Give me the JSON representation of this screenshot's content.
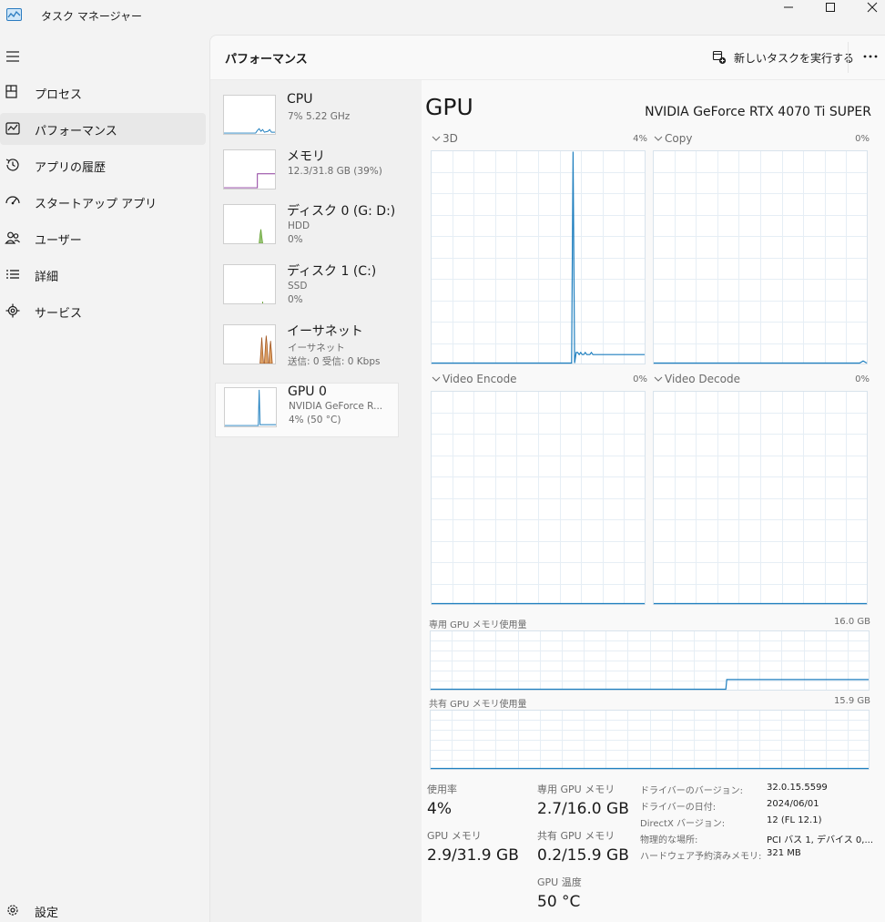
{
  "window": {
    "title": "タスク マネージャー",
    "accent": "#1f7fbf"
  },
  "sidebar": {
    "items": [
      {
        "label": "プロセス",
        "icon": "processes-icon",
        "selected": false
      },
      {
        "label": "パフォーマンス",
        "icon": "performance-icon",
        "selected": true
      },
      {
        "label": "アプリの履歴",
        "icon": "history-icon",
        "selected": false
      },
      {
        "label": "スタートアップ アプリ",
        "icon": "startup-icon",
        "selected": false
      },
      {
        "label": "ユーザー",
        "icon": "users-icon",
        "selected": false
      },
      {
        "label": "詳細",
        "icon": "details-icon",
        "selected": false
      },
      {
        "label": "サービス",
        "icon": "services-icon",
        "selected": false
      }
    ],
    "settings_label": "設定"
  },
  "header": {
    "title": "パフォーマンス",
    "new_task_label": "新しいタスクを実行する"
  },
  "devices": [
    {
      "name": "CPU",
      "sub1": "7%  5.22 GHz",
      "sub2": "",
      "color": "#1f7fbf"
    },
    {
      "name": "メモリ",
      "sub1": "12.3/31.8 GB (39%)",
      "sub2": "",
      "color": "#8b3a9c"
    },
    {
      "name": "ディスク 0 (G: D:)",
      "sub1": "HDD",
      "sub2": "0%",
      "color": "#5e9e2a"
    },
    {
      "name": "ディスク 1 (C:)",
      "sub1": "SSD",
      "sub2": "0%",
      "color": "#5e9e2a"
    },
    {
      "name": "イーサネット",
      "sub1": "イーサネット",
      "sub2": "送信: 0 受信: 0 Kbps",
      "color": "#a0521a"
    },
    {
      "name": "GPU 0",
      "sub1": "NVIDIA GeForce R...",
      "sub2": "4% (50 °C)",
      "color": "#1f7fbf"
    }
  ],
  "gpu": {
    "title": "GPU",
    "model": "NVIDIA GeForce RTX 4070 Ti SUPER",
    "engines": [
      {
        "name": "3D",
        "pct": "4%"
      },
      {
        "name": "Copy",
        "pct": "0%"
      },
      {
        "name": "Video Encode",
        "pct": "0%"
      },
      {
        "name": "Video Decode",
        "pct": "0%"
      }
    ],
    "dedicated_label": "専用 GPU メモリ使用量",
    "dedicated_max": "16.0 GB",
    "shared_label": "共有 GPU メモリ使用量",
    "shared_max": "15.9 GB",
    "stats": {
      "utilization_label": "使用率",
      "utilization_value": "4%",
      "gpu_memory_label": "GPU メモリ",
      "gpu_memory_value": "2.9/31.9 GB",
      "dedicated_memory_label": "専用 GPU メモリ",
      "dedicated_memory_value": "2.7/16.0 GB",
      "shared_memory_label": "共有 GPU メモリ",
      "shared_memory_value": "0.2/15.9 GB",
      "temp_label": "GPU 温度",
      "temp_value": "50 °C"
    },
    "properties": [
      {
        "label": "ドライバーのバージョン:",
        "value": "32.0.15.5599"
      },
      {
        "label": "ドライバーの日付:",
        "value": "2024/06/01"
      },
      {
        "label": "DirectX バージョン:",
        "value": "12 (FL 12.1)"
      },
      {
        "label": "物理的な場所:",
        "value": "PCI バス 1, デバイス 0,..."
      },
      {
        "label": "ハードウェア予約済みメモリ:",
        "value": "321 MB"
      }
    ]
  },
  "chart_data": [
    {
      "type": "line",
      "name": "3D",
      "ylim": [
        0,
        100
      ],
      "values": [
        0,
        0,
        0,
        0,
        0,
        0,
        0,
        0,
        0,
        0,
        0,
        0,
        0,
        0,
        0,
        0,
        0,
        0,
        0,
        0,
        0,
        0,
        0,
        0,
        0,
        0,
        0,
        0,
        0,
        0,
        0,
        0,
        0,
        0,
        0,
        0,
        0,
        0,
        0,
        0,
        0,
        0,
        0,
        0,
        0,
        0,
        0,
        0,
        0,
        0,
        0,
        0,
        0,
        0,
        0,
        0,
        0,
        0,
        0,
        0,
        0,
        0,
        0,
        0,
        0,
        0,
        0,
        0,
        0,
        0,
        0,
        0,
        0,
        0,
        0,
        0,
        0,
        0,
        0,
        0,
        0,
        0,
        0,
        0,
        0,
        0,
        0,
        0,
        0,
        0,
        0,
        0,
        0,
        100,
        0,
        5,
        5,
        4,
        5,
        4,
        4,
        5,
        4,
        4,
        4,
        5,
        4,
        4,
        4,
        4,
        4,
        4,
        4,
        4,
        4,
        4,
        4,
        4,
        4,
        4,
        4,
        4,
        4,
        4,
        4,
        4,
        4,
        4,
        4,
        4,
        4,
        4,
        4,
        4,
        4,
        4,
        4,
        4,
        4,
        4,
        4
      ]
    },
    {
      "type": "line",
      "name": "Copy",
      "ylim": [
        0,
        100
      ],
      "values": [
        0,
        0,
        0,
        0,
        0,
        0,
        0,
        0,
        0,
        0,
        0,
        0,
        0,
        0,
        0,
        0,
        0,
        0,
        0,
        0,
        0,
        0,
        0,
        0,
        0,
        0,
        0,
        0,
        0,
        0,
        0,
        0,
        0,
        0,
        0,
        0,
        0,
        0,
        0,
        0,
        0,
        0,
        0,
        0,
        0,
        0,
        0,
        0,
        0,
        0,
        0,
        0,
        0,
        0,
        0,
        0,
        0,
        0,
        1,
        0
      ]
    },
    {
      "type": "line",
      "name": "Video Encode",
      "ylim": [
        0,
        100
      ],
      "values": [
        0,
        0
      ]
    },
    {
      "type": "line",
      "name": "Video Decode",
      "ylim": [
        0,
        100
      ],
      "values": [
        0,
        0
      ]
    },
    {
      "type": "line",
      "name": "dedicated",
      "ylim": [
        0,
        16.0
      ],
      "values": [
        0,
        0,
        0,
        0,
        0,
        0,
        0,
        0,
        0,
        0,
        0,
        0,
        0,
        0,
        0,
        0,
        0,
        0,
        0,
        0,
        0,
        0,
        0,
        0,
        0,
        0,
        0,
        0,
        0,
        0,
        0,
        0,
        0,
        0,
        0,
        0,
        0,
        0,
        0,
        0,
        0,
        0,
        0,
        0,
        0,
        0,
        0,
        0,
        0,
        0,
        0,
        0,
        0,
        0,
        0,
        0,
        0,
        0,
        0,
        0,
        0,
        0,
        0,
        0,
        0,
        0,
        0,
        0,
        0,
        0,
        0,
        0,
        0,
        0,
        0,
        0,
        0,
        0,
        0,
        0,
        0,
        0,
        0,
        0,
        0,
        0,
        0,
        0,
        0,
        0,
        0,
        0,
        0,
        0,
        0,
        0,
        0,
        0,
        0,
        0,
        0,
        0,
        0,
        0,
        0,
        0,
        0,
        0,
        0,
        0,
        0,
        0,
        0,
        0,
        0,
        0,
        0,
        0,
        0,
        0,
        0,
        0,
        0,
        0,
        0,
        0,
        0,
        0,
        0,
        0,
        0,
        0,
        0,
        0,
        0,
        0,
        0,
        0,
        0,
        0,
        0,
        0,
        0,
        0,
        0,
        0,
        0,
        0,
        0,
        0,
        0,
        0,
        0,
        0,
        0,
        0,
        0,
        0,
        0,
        0,
        0,
        0,
        0,
        0,
        0,
        0,
        0,
        0,
        0,
        0,
        0,
        0,
        0,
        0,
        0,
        0,
        0,
        0,
        0,
        0,
        0,
        0,
        0,
        0,
        0,
        0,
        0,
        0,
        0,
        0,
        0,
        0,
        0,
        0,
        0,
        0,
        0,
        0,
        0,
        0,
        0,
        0,
        0,
        0,
        0,
        0,
        0,
        0,
        0,
        0,
        0,
        0,
        0,
        0,
        0,
        0,
        0,
        0,
        0,
        0,
        0,
        0,
        0,
        0,
        0,
        0,
        0,
        0,
        0,
        0,
        0,
        0,
        0,
        0,
        0,
        0,
        0,
        0,
        0,
        0,
        0,
        0,
        0,
        0,
        0,
        0,
        0,
        0,
        0,
        0,
        0,
        0,
        0,
        0,
        0,
        0,
        0,
        0,
        0,
        0,
        0,
        0,
        0,
        0,
        0,
        0,
        0,
        0,
        0,
        0,
        0,
        0,
        0,
        0,
        0,
        0,
        0,
        0,
        0,
        0,
        0,
        0,
        0,
        0,
        0,
        0,
        0,
        0,
        0,
        0,
        0,
        0,
        0,
        0,
        0,
        0,
        0,
        0,
        0,
        0,
        0,
        0,
        0,
        0,
        0,
        0,
        0,
        0,
        0,
        0,
        0,
        0,
        0,
        0,
        0,
        0,
        0,
        0,
        0,
        0,
        0,
        0,
        0,
        0,
        0,
        0,
        0,
        0,
        0,
        0,
        0,
        0,
        0,
        0,
        0,
        0,
        0,
        0,
        2.7,
        2.7,
        2.7,
        2.7,
        2.7,
        2.7,
        2.7,
        2.7,
        2.7,
        2.7,
        2.7,
        2.7,
        2.7,
        2.7,
        2.7,
        2.7,
        2.7,
        2.7,
        2.7,
        2.7,
        2.7,
        2.7,
        2.7,
        2.7,
        2.7,
        2.7,
        2.7,
        2.7,
        2.7,
        2.7,
        2.7,
        2.7,
        2.7,
        2.7,
        2.7,
        2.7,
        2.7,
        2.7,
        2.7,
        2.7,
        2.7,
        2.7,
        2.7,
        2.7,
        2.7,
        2.7,
        2.7,
        2.7,
        2.7,
        2.7,
        2.7,
        2.7,
        2.7,
        2.7,
        2.7,
        2.7,
        2.7,
        2.7,
        2.7,
        2.7,
        2.7,
        2.7,
        2.7,
        2.7,
        2.7,
        2.7,
        2.7,
        2.7,
        2.7,
        2.7,
        2.7,
        2.7,
        2.7,
        2.7,
        2.7,
        2.7,
        2.7,
        2.7,
        2.7,
        2.7,
        2.7,
        2.7,
        2.7,
        2.7,
        2.7,
        2.7,
        2.7,
        2.7,
        2.7,
        2.7,
        2.7,
        2.7,
        2.7,
        2.7,
        2.7,
        2.7,
        2.7,
        2.7,
        2.7,
        2.7,
        2.7,
        2.7,
        2.7,
        2.7,
        2.7,
        2.7,
        2.7,
        2.7,
        2.7,
        2.7,
        2.7,
        2.7,
        2.7,
        2.7,
        2.7,
        2.7,
        2.7,
        2.7,
        2.7,
        2.7,
        2.7,
        2.7,
        2.7,
        2.7,
        2.7,
        2.7,
        2.7,
        2.7,
        2.7,
        2.7,
        2.7,
        2.7,
        2.7,
        2.7,
        2.7,
        2.7,
        2.7,
        2.7,
        2.7,
        2.7,
        2.7,
        2.7,
        2.7,
        2.7,
        2.7,
        2.7,
        2.7,
        2.7,
        2.7,
        2.7,
        2.7,
        2.7,
        2.7,
        2.7,
        2.7,
        2.7,
        2.7,
        2.7,
        2.7,
        2.7,
        2.7,
        2.7,
        2.7
      ]
    },
    {
      "type": "line",
      "name": "shared",
      "ylim": [
        0,
        15.9
      ],
      "values": [
        0,
        0
      ]
    }
  ]
}
